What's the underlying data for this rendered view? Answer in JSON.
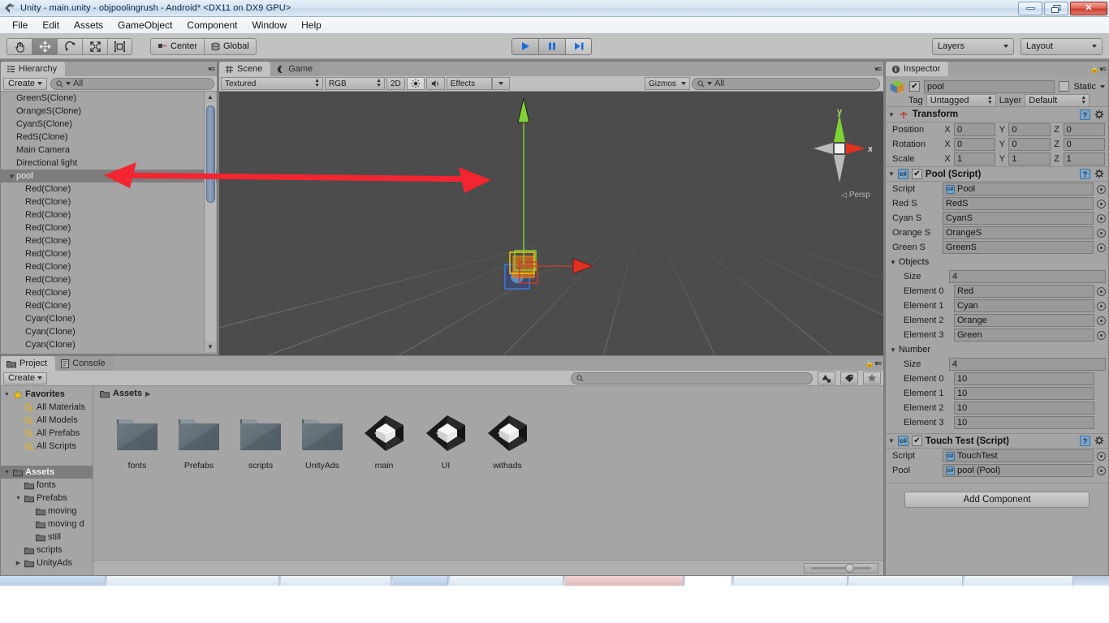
{
  "window": {
    "title": "Unity - main.unity - objpoolingrush - Android* <DX11 on DX9 GPU>",
    "minimize_label": "Minimize",
    "restore_label": "Restore",
    "close_label": "✕"
  },
  "menubar": {
    "items": [
      "File",
      "Edit",
      "Assets",
      "GameObject",
      "Component",
      "Window",
      "Help"
    ]
  },
  "toolbar": {
    "tools": [
      {
        "name": "hand-tool",
        "label": "Hand"
      },
      {
        "name": "move-tool",
        "label": "Move"
      },
      {
        "name": "rotate-tool",
        "label": "Rotate"
      },
      {
        "name": "scale-tool",
        "label": "Scale"
      },
      {
        "name": "rect-tool",
        "label": "Rect"
      }
    ],
    "pivot_label": "Center",
    "space_label": "Global",
    "play_label": "Play",
    "pause_label": "Pause",
    "step_label": "Step",
    "layers_label": "Layers",
    "layout_label": "Layout"
  },
  "hierarchy": {
    "tab_label": "Hierarchy",
    "create_label": "Create",
    "search_placeholder": "All",
    "items": [
      {
        "label": "GreenS(Clone)",
        "depth": 0,
        "selected": false,
        "expandable": false
      },
      {
        "label": "OrangeS(Clone)",
        "depth": 0,
        "selected": false,
        "expandable": false
      },
      {
        "label": "CyanS(Clone)",
        "depth": 0,
        "selected": false,
        "expandable": false
      },
      {
        "label": "RedS(Clone)",
        "depth": 0,
        "selected": false,
        "expandable": false
      },
      {
        "label": "Main Camera",
        "depth": 0,
        "selected": false,
        "expandable": false
      },
      {
        "label": "Directional light",
        "depth": 0,
        "selected": false,
        "expandable": false
      },
      {
        "label": "pool",
        "depth": 0,
        "selected": true,
        "expandable": true
      },
      {
        "label": "Red(Clone)",
        "depth": 1,
        "selected": false,
        "expandable": false
      },
      {
        "label": "Red(Clone)",
        "depth": 1,
        "selected": false,
        "expandable": false
      },
      {
        "label": "Red(Clone)",
        "depth": 1,
        "selected": false,
        "expandable": false
      },
      {
        "label": "Red(Clone)",
        "depth": 1,
        "selected": false,
        "expandable": false
      },
      {
        "label": "Red(Clone)",
        "depth": 1,
        "selected": false,
        "expandable": false
      },
      {
        "label": "Red(Clone)",
        "depth": 1,
        "selected": false,
        "expandable": false
      },
      {
        "label": "Red(Clone)",
        "depth": 1,
        "selected": false,
        "expandable": false
      },
      {
        "label": "Red(Clone)",
        "depth": 1,
        "selected": false,
        "expandable": false
      },
      {
        "label": "Red(Clone)",
        "depth": 1,
        "selected": false,
        "expandable": false
      },
      {
        "label": "Red(Clone)",
        "depth": 1,
        "selected": false,
        "expandable": false
      },
      {
        "label": "Cyan(Clone)",
        "depth": 1,
        "selected": false,
        "expandable": false
      },
      {
        "label": "Cyan(Clone)",
        "depth": 1,
        "selected": false,
        "expandable": false
      },
      {
        "label": "Cyan(Clone)",
        "depth": 1,
        "selected": false,
        "expandable": false
      }
    ]
  },
  "scene": {
    "tab_label": "Scene",
    "game_tab_label": "Game",
    "draw_mode": "Textured",
    "color_mode": "RGB",
    "toggle_2d": "2D",
    "light_toggle": "lighting-icon",
    "audio_toggle": "audio-icon",
    "effects_label": "Effects",
    "gizmos_label": "Gizmos",
    "search_placeholder": "All",
    "axis_x": "x",
    "axis_y": "y",
    "persp_label": "Persp"
  },
  "project": {
    "tab_label": "Project",
    "console_tab_label": "Console",
    "create_label": "Create",
    "search_placeholder": "",
    "breadcrumb": "Assets",
    "tree": [
      {
        "label": "Favorites",
        "indent": 0,
        "icon": "star-icon",
        "twist": "down",
        "bold": true,
        "selected": false
      },
      {
        "label": "All Materials",
        "indent": 1,
        "icon": "search-icon",
        "twist": "",
        "bold": false,
        "selected": false
      },
      {
        "label": "All Models",
        "indent": 1,
        "icon": "search-icon",
        "twist": "",
        "bold": false,
        "selected": false
      },
      {
        "label": "All Prefabs",
        "indent": 1,
        "icon": "search-icon",
        "twist": "",
        "bold": false,
        "selected": false
      },
      {
        "label": "All Scripts",
        "indent": 1,
        "icon": "search-icon",
        "twist": "",
        "bold": false,
        "selected": false
      },
      {
        "label": "",
        "indent": 0,
        "icon": "",
        "twist": "",
        "bold": false,
        "selected": false
      },
      {
        "label": "Assets",
        "indent": 0,
        "icon": "folder-icon",
        "twist": "down",
        "bold": true,
        "selected": true
      },
      {
        "label": "fonts",
        "indent": 1,
        "icon": "folder-icon",
        "twist": "",
        "bold": false,
        "selected": false
      },
      {
        "label": "Prefabs",
        "indent": 1,
        "icon": "folder-icon",
        "twist": "down",
        "bold": false,
        "selected": false
      },
      {
        "label": "moving",
        "indent": 2,
        "icon": "folder-icon",
        "twist": "",
        "bold": false,
        "selected": false
      },
      {
        "label": "moving d",
        "indent": 2,
        "icon": "folder-icon",
        "twist": "",
        "bold": false,
        "selected": false
      },
      {
        "label": "still",
        "indent": 2,
        "icon": "folder-icon",
        "twist": "",
        "bold": false,
        "selected": false
      },
      {
        "label": "scripts",
        "indent": 1,
        "icon": "folder-icon",
        "twist": "",
        "bold": false,
        "selected": false
      },
      {
        "label": "UnityAds",
        "indent": 1,
        "icon": "folder-icon",
        "twist": "right",
        "bold": false,
        "selected": false
      }
    ],
    "assets": [
      {
        "label": "fonts",
        "kind": "folder"
      },
      {
        "label": "Prefabs",
        "kind": "folder"
      },
      {
        "label": "scripts",
        "kind": "folder"
      },
      {
        "label": "UnityAds",
        "kind": "folder"
      },
      {
        "label": "main",
        "kind": "scene"
      },
      {
        "label": "UI",
        "kind": "scene"
      },
      {
        "label": "withads",
        "kind": "scene"
      }
    ]
  },
  "inspector": {
    "tab_label": "Inspector",
    "object_name": "pool",
    "static_label": "Static",
    "tag_label": "Tag",
    "tag_value": "Untagged",
    "layer_label": "Layer",
    "layer_value": "Default",
    "transform": {
      "title": "Transform",
      "rows": [
        {
          "label": "Position",
          "x": "0",
          "y": "0",
          "z": "0"
        },
        {
          "label": "Rotation",
          "x": "0",
          "y": "0",
          "z": "0"
        },
        {
          "label": "Scale",
          "x": "1",
          "y": "1",
          "z": "1"
        }
      ],
      "axis_labels": [
        "X",
        "Y",
        "Z"
      ]
    },
    "pool_script": {
      "title": "Pool (Script)",
      "fields": [
        {
          "label": "Script",
          "value": "Pool",
          "has_icon": true
        },
        {
          "label": "Red S",
          "value": "RedS",
          "has_icon": false
        },
        {
          "label": "Cyan S",
          "value": "CyanS",
          "has_icon": false
        },
        {
          "label": "Orange S",
          "value": "OrangeS",
          "has_icon": false
        },
        {
          "label": "Green S",
          "value": "GreenS",
          "has_icon": false
        }
      ],
      "objects_array": {
        "title": "Objects",
        "size_label": "Size",
        "size_value": "4",
        "elements": [
          {
            "label": "Element 0",
            "value": "Red"
          },
          {
            "label": "Element 1",
            "value": "Cyan"
          },
          {
            "label": "Element 2",
            "value": "Orange"
          },
          {
            "label": "Element 3",
            "value": "Green"
          }
        ]
      },
      "number_array": {
        "title": "Number",
        "size_label": "Size",
        "size_value": "4",
        "elements": [
          {
            "label": "Element 0",
            "value": "10"
          },
          {
            "label": "Element 1",
            "value": "10"
          },
          {
            "label": "Element 2",
            "value": "10"
          },
          {
            "label": "Element 3",
            "value": "10"
          }
        ]
      }
    },
    "touch_test_script": {
      "title": "Touch Test (Script)",
      "fields": [
        {
          "label": "Script",
          "value": "TouchTest",
          "has_icon": true
        },
        {
          "label": "Pool",
          "value": "pool (Pool)",
          "has_icon": true
        }
      ]
    },
    "add_component_label": "Add Component"
  },
  "colors": {
    "accent_red": "#f22531",
    "panel_bg": "#a5a5a5",
    "scene_bg": "#4c4c4c",
    "axis_x": "#e03020",
    "axis_y": "#7fd233",
    "selection": "#7d7d7d"
  }
}
